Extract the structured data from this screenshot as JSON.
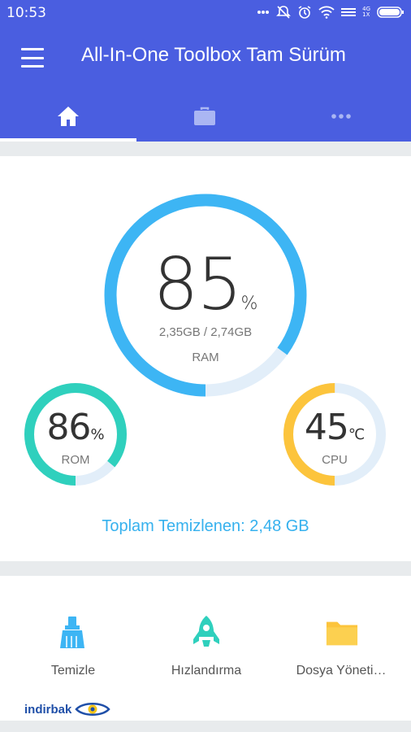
{
  "status_bar": {
    "time": "10:53",
    "network_top": "4G",
    "network_bottom": "1X",
    "icons": [
      "more-dots-icon",
      "mute-icon",
      "alarm-icon",
      "wifi-icon",
      "signal-icon",
      "battery-icon"
    ]
  },
  "app_bar": {
    "title": "All-In-One Toolbox Tam Sürüm",
    "menu_icon": "hamburger-menu-icon"
  },
  "tabs": [
    {
      "icon": "home-icon",
      "selected": true
    },
    {
      "icon": "briefcase-icon",
      "selected": false
    },
    {
      "icon": "more-horizontal-icon",
      "selected": false
    }
  ],
  "ram": {
    "percent": 85,
    "percent_display": "85",
    "unit": "%",
    "detail": "2,35GB / 2,74GB",
    "label": "RAM"
  },
  "rom": {
    "percent": 86,
    "percent_display": "86",
    "unit": "%",
    "label": "ROM"
  },
  "cpu": {
    "temperature": 45,
    "temperature_display": "45",
    "unit": "℃",
    "label": "CPU",
    "gauge_fraction": 0.5
  },
  "total_cleaned": "Toplam Temizlenen: 2,48 GB",
  "tools": [
    {
      "label": "Temizle",
      "icon": "broom-icon"
    },
    {
      "label": "Hızlandırma",
      "icon": "rocket-icon"
    },
    {
      "label": "Dosya Yöneti…",
      "icon": "folder-icon"
    }
  ],
  "watermark": {
    "text": "indirbak"
  },
  "colors": {
    "header": "#4a5ee0",
    "ram_ring": "#3db5f4",
    "rom_ring": "#2fd0bd",
    "cpu_ring": "#fcc43c",
    "ring_track": "#e2eef9",
    "accent_text": "#36b1ee"
  }
}
